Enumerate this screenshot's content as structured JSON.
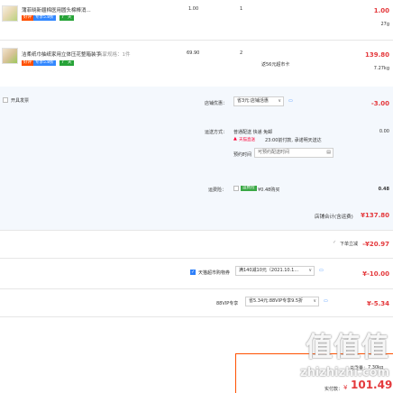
{
  "items": [
    {
      "name": "蒲菲晓新疆棉医用圆头棉棒消...",
      "tag_labels": [
        "好评",
        "专享5.8折",
        "7",
        "天"
      ],
      "spec": "",
      "unit_price": "1.00",
      "qty": "1",
      "promo": "",
      "subtotal": "1.00",
      "weight": "27g"
    },
    {
      "name": "洁柔纸巾抽纸家用立体压花整箱装手...",
      "tag_labels": [
        "好评",
        "专享5.8折",
        "7",
        "天"
      ],
      "spec": "商家规格：1件",
      "unit_price": "69.90",
      "qty": "2",
      "promo": "返56元超市卡",
      "subtotal": "139.80",
      "weight": "7.27kg"
    }
  ],
  "store": {
    "select_all": "开具发票",
    "discount_label": "店铺优惠：",
    "discount_select": "省3元:店铺活惠",
    "discount_amount": "-3.00",
    "shipping_label": "运送方式：",
    "shipping_value": "普通配送 快递 免邮",
    "shipping_fee": "0.00",
    "express_badge": "天猫直送",
    "express_text": "23:00前付款, 承诺明天送达",
    "appoint_label": "预约时间",
    "appoint_placeholder": "可预约配送时间",
    "insurance_label": "运费险：",
    "insurance_tag": "运费险",
    "insurance_text": "¥0.48购买",
    "insurance_amount": "0.48",
    "store_total_label": "店铺合计(含运费)",
    "store_total": "¥137.80"
  },
  "discounts": {
    "order_label": "下单立减",
    "order_amount": "-¥20.97",
    "coupon_label": "天猫超市购物券",
    "coupon_select": "满140减10元（2021.10.1...",
    "coupon_amount": "¥-10.00",
    "vip_label": "88VIP专享",
    "vip_select": "省5.34元:88VIP专享9.5折",
    "vip_amount": "¥-5.34"
  },
  "summary": {
    "weight_label": "总重量：",
    "weight_value": "7.30kg",
    "pay_label": "实付款：",
    "currency": "¥",
    "pay_value": "101.49"
  },
  "watermark": {
    "big": "值值值",
    "site": "zhizhizhi.com"
  },
  "colors": {
    "accent": "#e4393c",
    "tmall_red": "#ff5000",
    "section_bg": "#f4f8fd",
    "checkbox_blue": "#2d7ff9"
  }
}
